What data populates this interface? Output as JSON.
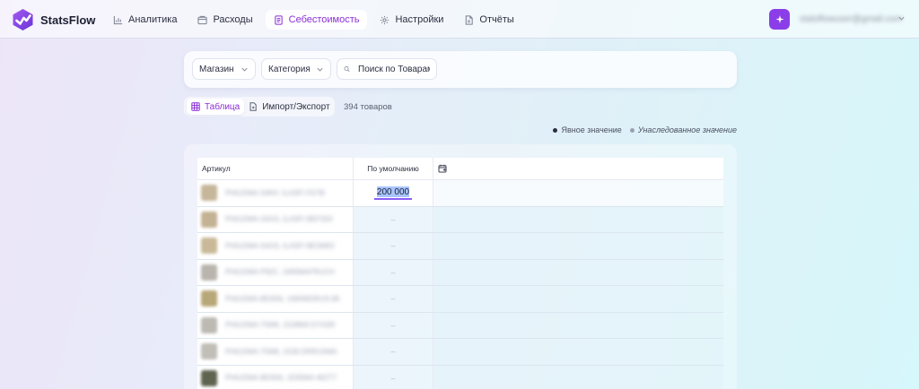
{
  "app": {
    "name": "StatsFlow",
    "brand_color": "#8b3ee8"
  },
  "nav": {
    "items": [
      {
        "label": "Аналитика",
        "icon": "bar-chart-icon"
      },
      {
        "label": "Расходы",
        "icon": "wallet-icon"
      },
      {
        "label": "Себестоимость",
        "icon": "document-icon",
        "active": true
      },
      {
        "label": "Настройки",
        "icon": "gear-icon"
      },
      {
        "label": "Отчёты",
        "icon": "report-icon"
      }
    ]
  },
  "user": {
    "email": "statsflowuser@gmail.com"
  },
  "filters": {
    "store_label": "Магазин",
    "category_label": "Категория",
    "search_placeholder": "Поиск по Товарам"
  },
  "view": {
    "table_label": "Таблица",
    "import_label": "Импорт/Экспорт",
    "count_text": "394 товаров"
  },
  "legend": {
    "explicit": "Явное значение",
    "inherited": "Унаследованное значение",
    "explicit_color": "#2b2f40",
    "inherited_color": "#9aa0b2"
  },
  "table": {
    "headers": {
      "article": "Артикул",
      "default": "По умолчанию"
    },
    "rows": [
      {
        "sku": "PH0J2WA-S4NY, ILASFI FD7B",
        "value": "200 000",
        "thumb": "#c6b69a"
      },
      {
        "sku": "PH0J2WA-S4XS, ILASFI BEFSDI",
        "value": "–",
        "thumb": "#c4b294"
      },
      {
        "sku": "PH0J2WA-S4XS, ILASFI BESMDI",
        "value": "–",
        "thumb": "#c9b998"
      },
      {
        "sku": "PH0J2WA-P92C, 1695MAFRUCH",
        "value": "–",
        "thumb": "#b9b5ae"
      },
      {
        "sku": "PH0J2WA-BE9S6, 1695MDRUS-96",
        "value": "–",
        "thumb": "#b8a778"
      },
      {
        "sku": "PH0J2WA-T5M6, 1528MA D7ASR",
        "value": "–",
        "thumb": "#bdbab4"
      },
      {
        "sku": "PH0J2WA-T5M6, 1528 DRRUSMA",
        "value": "–",
        "thumb": "#c1beb8"
      },
      {
        "sku": "PH0J2WA-BE9S6, 1E95MA 46ZT7",
        "value": "–",
        "thumb": "#5e6450"
      }
    ]
  }
}
